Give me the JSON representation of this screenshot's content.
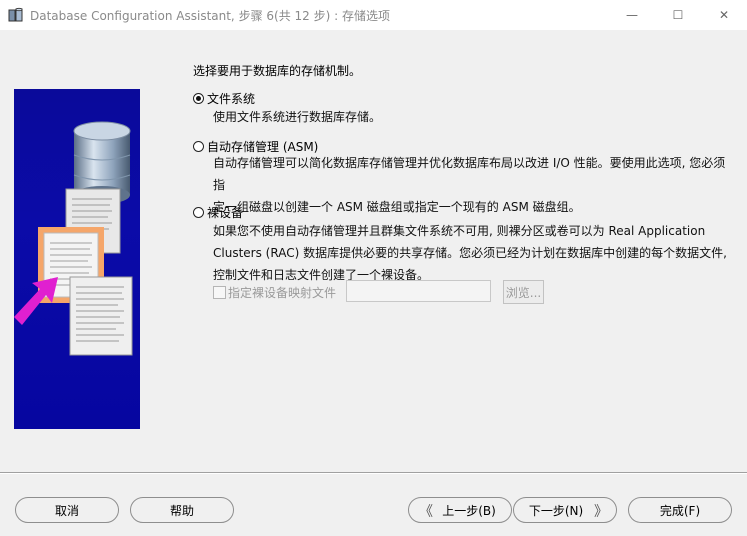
{
  "window": {
    "title": "Database Configuration Assistant, 步骤 6(共 12 步) : 存储选项",
    "controls": {
      "minimize": "—",
      "maximize": "☐",
      "close": "✕"
    }
  },
  "main": {
    "prompt": "选择要用于数据库的存储机制。",
    "options": [
      {
        "label": "文件系统",
        "checked": true,
        "description": [
          "使用文件系统进行数据库存储。"
        ]
      },
      {
        "label": "自动存储管理 (ASM)",
        "checked": false,
        "description": [
          "自动存储管理可以简化数据库存储管理并优化数据库布局以改进 I/O 性能。要使用此选项, 您必须指",
          "定一组磁盘以创建一个 ASM 磁盘组或指定一个现有的 ASM 磁盘组。"
        ]
      },
      {
        "label": "裸设备",
        "checked": false,
        "description": [
          "如果您不使用自动存储管理并且群集文件系统不可用, 则裸分区或卷可以为 Real Application",
          "Clusters (RAC) 数据库提供必要的共享存储。您必须已经为计划在数据库中创建的每个数据文件,",
          "控制文件和日志文件创建了一个裸设备。"
        ]
      }
    ],
    "raw_mapping": {
      "checkbox_label": "指定裸设备映射文件",
      "checked": false,
      "file_value": "",
      "browse_label": "浏览..."
    }
  },
  "footer": {
    "cancel": "取消",
    "help": "帮助",
    "back": "上一步(B)",
    "next": "下一步(N)",
    "finish": "完成(F)",
    "back_arrow": "《",
    "next_arrow": "》"
  },
  "colors": {
    "image_bg": "#0a0a9a",
    "arrow": "#e020d0",
    "accent_doc": "#f0a060"
  }
}
